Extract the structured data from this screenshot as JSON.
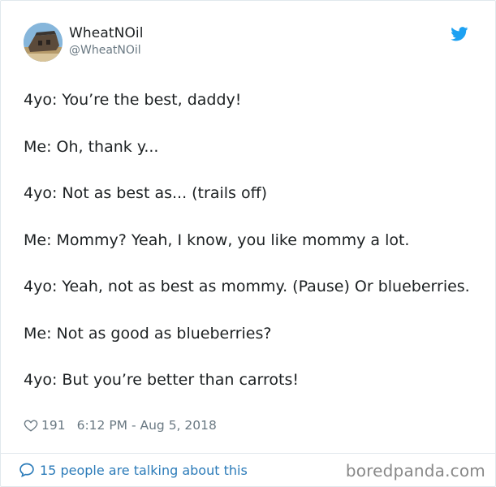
{
  "user": {
    "display_name": "WheatNOil",
    "handle": "@WheatNOil"
  },
  "tweet": {
    "lines": [
      "4yo: You’re the best, daddy!",
      "Me: Oh, thank y...",
      "4yo: Not as best as... (trails off)",
      "Me: Mommy? Yeah, I know, you like mommy a lot.",
      "4yo: Yeah, not as best as mommy. (Pause) Or blueberries.",
      "Me: Not as good as blueberries?",
      "4yo: But you’re better than carrots!"
    ],
    "likes": "191",
    "timestamp": "6:12 PM - Aug 5, 2018"
  },
  "footer": {
    "talking_label": "15 people are talking about this"
  },
  "watermark": "boredpanda.com",
  "colors": {
    "twitter_blue": "#1da1f2",
    "link_blue": "#2b7bb9",
    "meta_gray": "#697882"
  },
  "icons": {
    "brand": "twitter-bird-icon",
    "like": "heart-icon",
    "reply": "speech-bubble-icon"
  }
}
